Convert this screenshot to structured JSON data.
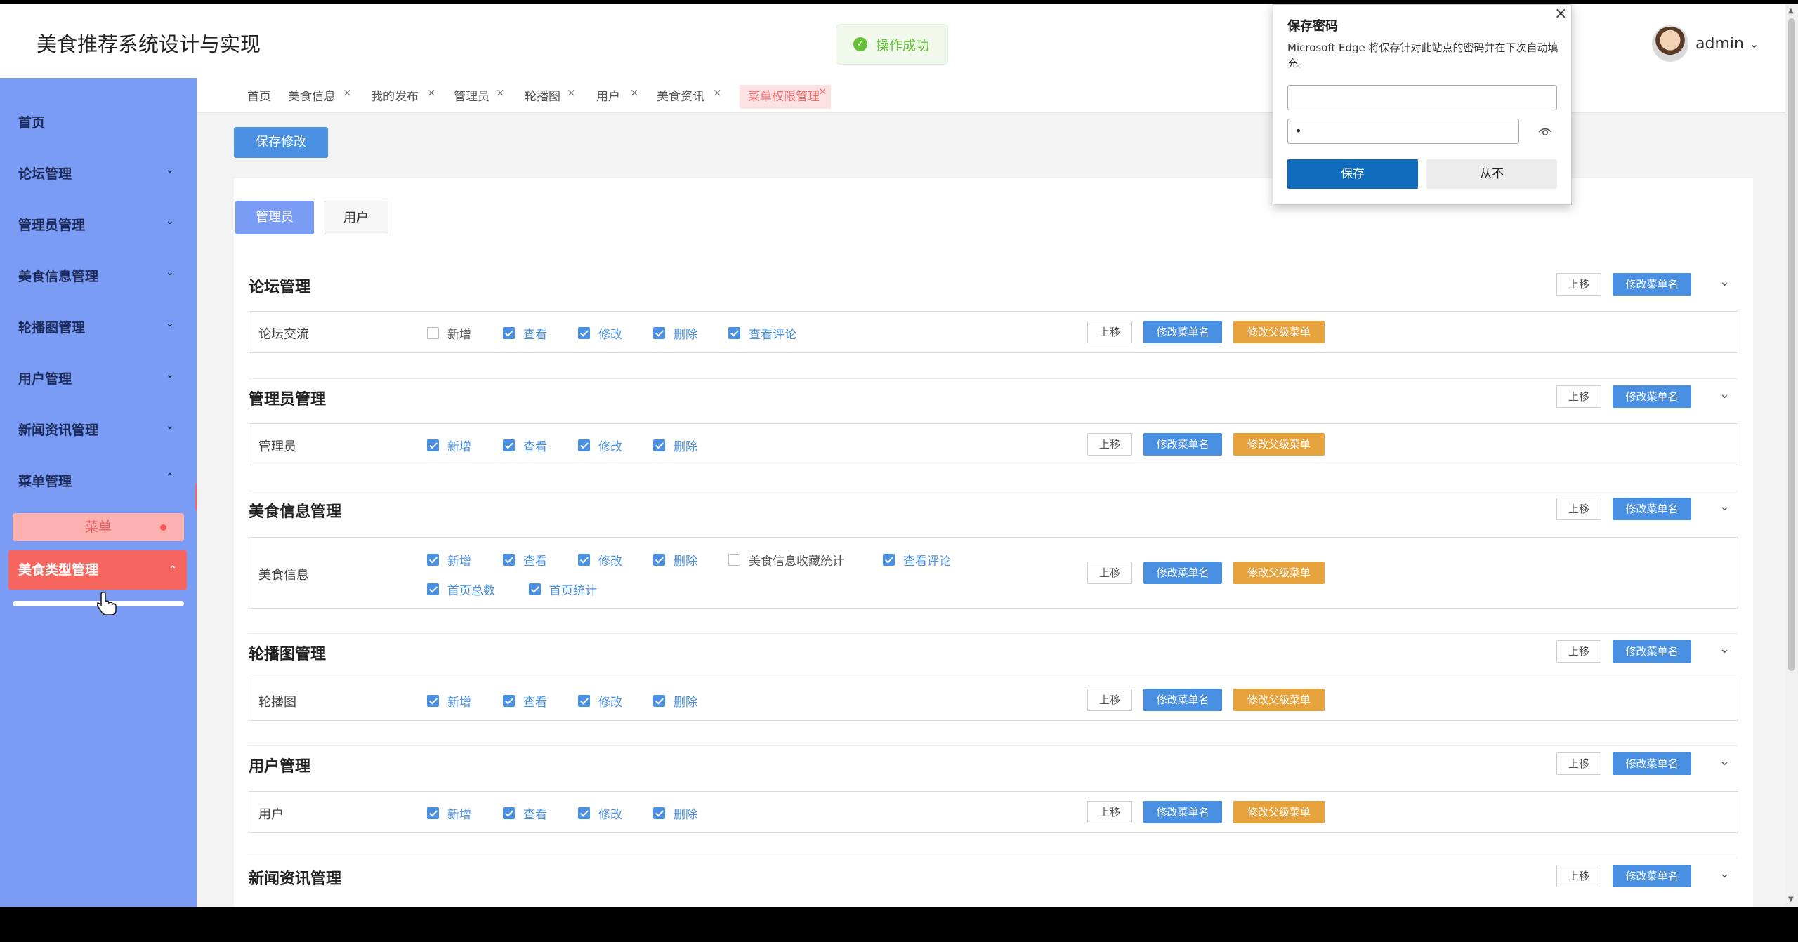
{
  "app": {
    "title": "美食推荐系统设计与实现"
  },
  "toast": {
    "message": "操作成功"
  },
  "user": {
    "name": "admin"
  },
  "sidebar": {
    "items": [
      {
        "label": "首页"
      },
      {
        "label": "论坛管理"
      },
      {
        "label": "管理员管理"
      },
      {
        "label": "美食信息管理"
      },
      {
        "label": "轮播图管理"
      },
      {
        "label": "用户管理"
      },
      {
        "label": "新闻资讯管理"
      },
      {
        "label": "菜单管理"
      }
    ],
    "sub1": "菜单",
    "sub2": "美食类型管理"
  },
  "tabs": [
    "首页",
    "美食信息",
    "我的发布",
    "管理员",
    "轮播图",
    "用户",
    "美食资讯",
    "菜单权限管理"
  ],
  "toolbar": {
    "save_label": "保存修改"
  },
  "roles": {
    "admin": "管理员",
    "user": "用户"
  },
  "buttons": {
    "up": "上移",
    "rename": "修改菜单名",
    "parent": "修改父级菜单"
  },
  "sections": [
    {
      "title": "论坛管理",
      "row": "论坛交流",
      "perms": [
        {
          "label": "新增",
          "checked": false
        },
        {
          "label": "查看",
          "checked": true
        },
        {
          "label": "修改",
          "checked": true
        },
        {
          "label": "删除",
          "checked": true
        },
        {
          "label": "查看评论",
          "checked": true
        }
      ]
    },
    {
      "title": "管理员管理",
      "row": "管理员",
      "perms": [
        {
          "label": "新增",
          "checked": true
        },
        {
          "label": "查看",
          "checked": true
        },
        {
          "label": "修改",
          "checked": true
        },
        {
          "label": "删除",
          "checked": true
        }
      ]
    },
    {
      "title": "美食信息管理",
      "row": "美食信息",
      "perms": [
        {
          "label": "新增",
          "checked": true
        },
        {
          "label": "查看",
          "checked": true
        },
        {
          "label": "修改",
          "checked": true
        },
        {
          "label": "删除",
          "checked": true
        },
        {
          "label": "美食信息收藏统计",
          "checked": false
        },
        {
          "label": "查看评论",
          "checked": true
        },
        {
          "label": "首页总数",
          "checked": true
        },
        {
          "label": "首页统计",
          "checked": true
        }
      ]
    },
    {
      "title": "轮播图管理",
      "row": "轮播图",
      "perms": [
        {
          "label": "新增",
          "checked": true
        },
        {
          "label": "查看",
          "checked": true
        },
        {
          "label": "修改",
          "checked": true
        },
        {
          "label": "删除",
          "checked": true
        }
      ]
    },
    {
      "title": "用户管理",
      "row": "用户",
      "perms": [
        {
          "label": "新增",
          "checked": true
        },
        {
          "label": "查看",
          "checked": true
        },
        {
          "label": "修改",
          "checked": true
        },
        {
          "label": "删除",
          "checked": true
        }
      ]
    },
    {
      "title": "新闻资讯管理"
    }
  ],
  "password_popup": {
    "title": "保存密码",
    "message": "Microsoft Edge 将保存针对此站点的密码并在下次自动填充。",
    "password_value": "•",
    "save": "保存",
    "never": "从不"
  },
  "colors": {
    "sidebar": "#7b9cf5",
    "primary": "#4a90e2",
    "warning": "#e6a23c",
    "danger": "#f6655e",
    "success": "#67c23a"
  }
}
